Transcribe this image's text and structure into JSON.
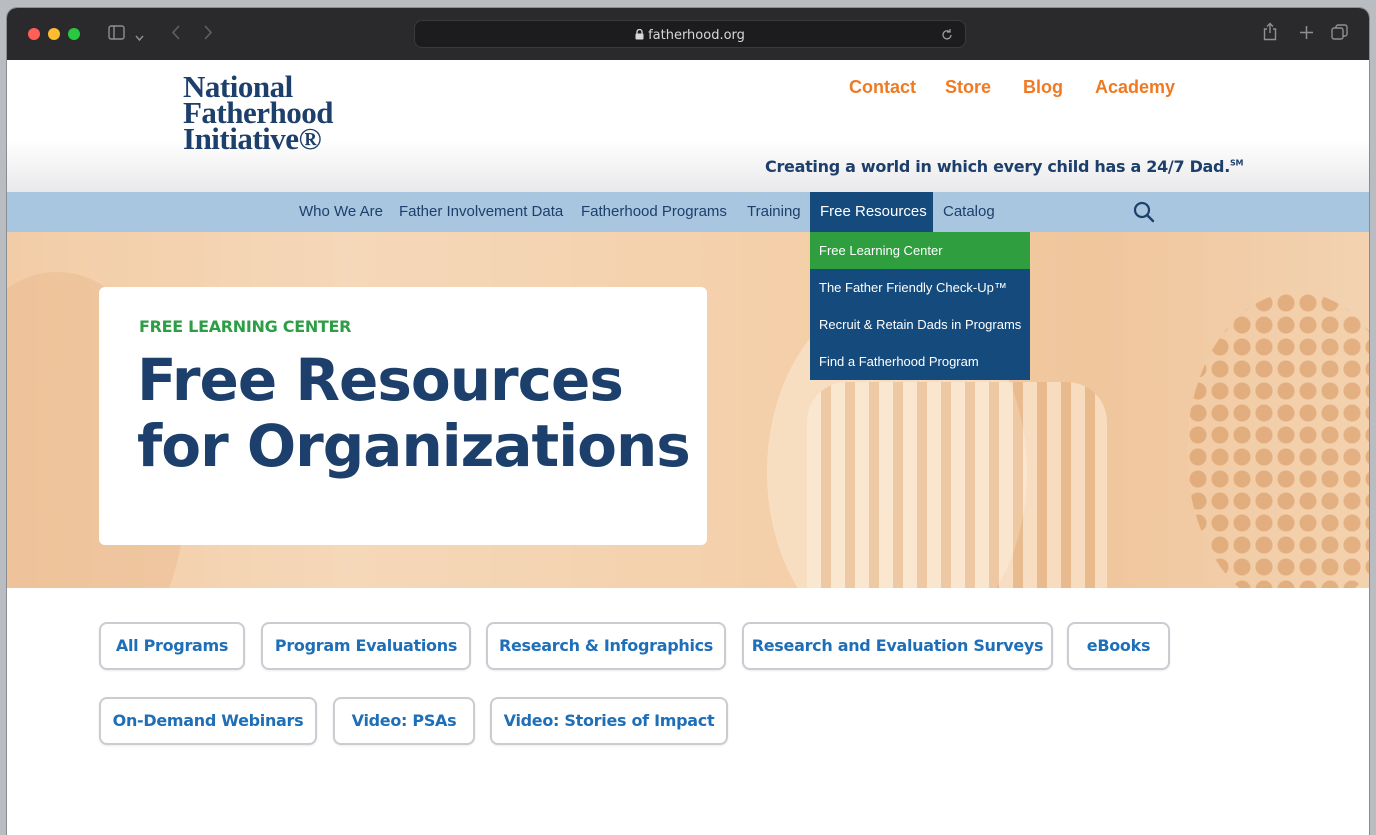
{
  "browser": {
    "url": "fatherhood.org",
    "icons": [
      "sidebar-icon",
      "chevron-down-icon",
      "back-icon",
      "forward-icon",
      "lock-icon",
      "reload-icon",
      "share-icon",
      "new-tab-icon",
      "tabs-icon"
    ]
  },
  "header": {
    "logo_lines": [
      "National",
      "Fatherhood",
      "Initiative®"
    ],
    "top_links": [
      "Contact",
      "Store",
      "Blog",
      "Academy"
    ],
    "tagline": "Creating a world in which every child has a 24/7 Dad.",
    "tagline_mark": "SM",
    "accent_color": "#f07a23"
  },
  "nav": {
    "items": [
      "Who We Are",
      "Father Involvement Data",
      "Fatherhood Programs",
      "Training",
      "Free Resources",
      "Catalog"
    ],
    "active": "Free Resources",
    "search_icon": "search-icon"
  },
  "dropdown": {
    "items": [
      "Free Learning Center",
      "The Father Friendly Check-Up™",
      "Recruit & Retain Dads in Programs",
      "Find a Fatherhood Program"
    ],
    "highlighted": "Free Learning Center"
  },
  "hero": {
    "kicker": "FREE LEARNING CENTER",
    "title": "Free Resources for Organizations"
  },
  "filters": {
    "row1": [
      "All Programs",
      "Program Evaluations",
      "Research & Infographics",
      "Research and Evaluation Surveys",
      "eBooks"
    ],
    "row2": [
      "On-Demand Webinars",
      "Video: PSAs",
      "Video: Stories of Impact"
    ]
  },
  "colors": {
    "brand_blue": "#1d3f6b",
    "nav_bg": "#a8c6e0",
    "active_nav": "#154a7d",
    "highlight_green": "#2f9e3f",
    "kicker_green": "#2e9e46",
    "button_text": "#1f6fb8"
  }
}
